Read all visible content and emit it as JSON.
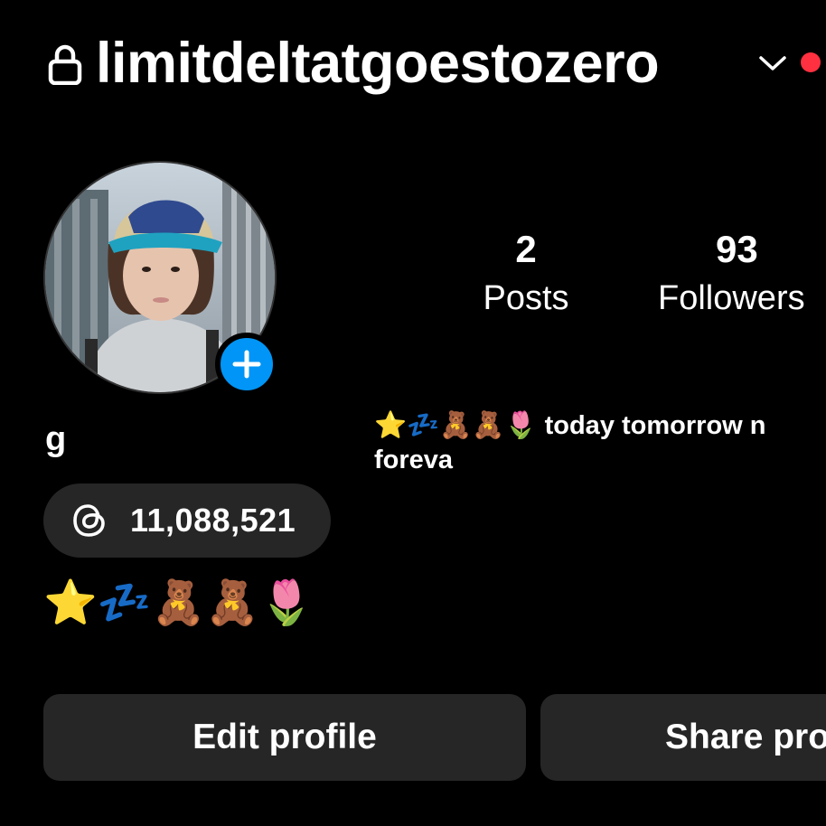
{
  "header": {
    "username": "limitdeltatgoestozero",
    "lock_icon": "lock-icon",
    "chevron_icon": "chevron-down-icon",
    "notification_color": "#ff3040"
  },
  "profile": {
    "avatar_icon": "avatar",
    "add_story_icon": "plus-icon",
    "add_story_color": "#0095f6",
    "display_name": "g",
    "note": "⭐💤🧸🧸🌷 today tomorrow n foreva"
  },
  "stats": [
    {
      "value": "2",
      "label": "Posts"
    },
    {
      "value": "93",
      "label": "Followers"
    }
  ],
  "threads": {
    "icon": "threads-icon",
    "count": "11,088,521"
  },
  "bio": {
    "emojis": "⭐💤🧸🧸🌷"
  },
  "buttons": {
    "edit_profile": "Edit profile",
    "share_profile": "Share profile"
  }
}
